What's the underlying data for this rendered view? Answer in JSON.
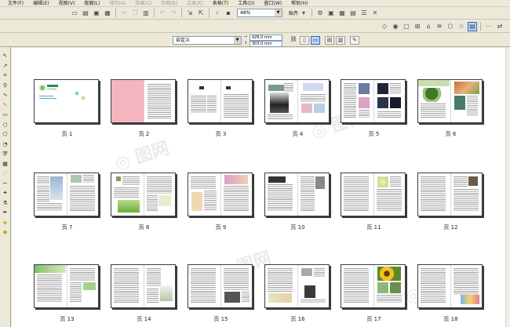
{
  "menu": [
    "文件(F)",
    "编辑(E)",
    "视图(V)",
    "版面(L)",
    "排列(A)",
    "效果(C)",
    "位图(B)",
    "文本(X)",
    "表格(T)",
    "工具(O)",
    "窗口(W)",
    "帮助(H)"
  ],
  "menu_dim": [
    false,
    false,
    false,
    false,
    true,
    true,
    true,
    true,
    false,
    false,
    false,
    false
  ],
  "toolbar": {
    "zoom_value": "48%",
    "align_label": "贴齐"
  },
  "propbar": {
    "paper_type": "自定义",
    "width": "426.0 mm",
    "height": "303.0 mm"
  },
  "toolbox_icons": [
    "pick-tool",
    "shape-tool",
    "crop-tool",
    "zoom-tool",
    "freehand-tool",
    "smart-fill-tool",
    "rectangle-tool",
    "ellipse-tool",
    "polygon-tool",
    "basic-shapes-tool",
    "text-tool",
    "table-tool",
    "dimension-tool",
    "connector-tool",
    "interactive-tool",
    "eyedropper-tool",
    "outline-tool",
    "fill-tool",
    "interactive-fill-tool"
  ],
  "pages": [
    {
      "label": "页 1",
      "style": "cover"
    },
    {
      "label": "页 2",
      "style": "pink"
    },
    {
      "label": "页 3",
      "style": "toc"
    },
    {
      "label": "页 4",
      "style": "photo-person"
    },
    {
      "label": "页 5",
      "style": "dark-photos"
    },
    {
      "label": "页 6",
      "style": "nature"
    },
    {
      "label": "页 7",
      "style": "building"
    },
    {
      "label": "页 8",
      "style": "green-plant"
    },
    {
      "label": "页 9",
      "style": "food"
    },
    {
      "label": "页 10",
      "style": "text-photo"
    },
    {
      "label": "页 11",
      "style": "flower"
    },
    {
      "label": "页 12",
      "style": "text-portrait"
    },
    {
      "label": "页 13",
      "style": "green-layout"
    },
    {
      "label": "页 14",
      "style": "sketch"
    },
    {
      "label": "页 15",
      "style": "text-photo-bw"
    },
    {
      "label": "页 16",
      "style": "people"
    },
    {
      "label": "页 17",
      "style": "sunflower"
    },
    {
      "label": "页 18",
      "style": "cartoon"
    }
  ]
}
